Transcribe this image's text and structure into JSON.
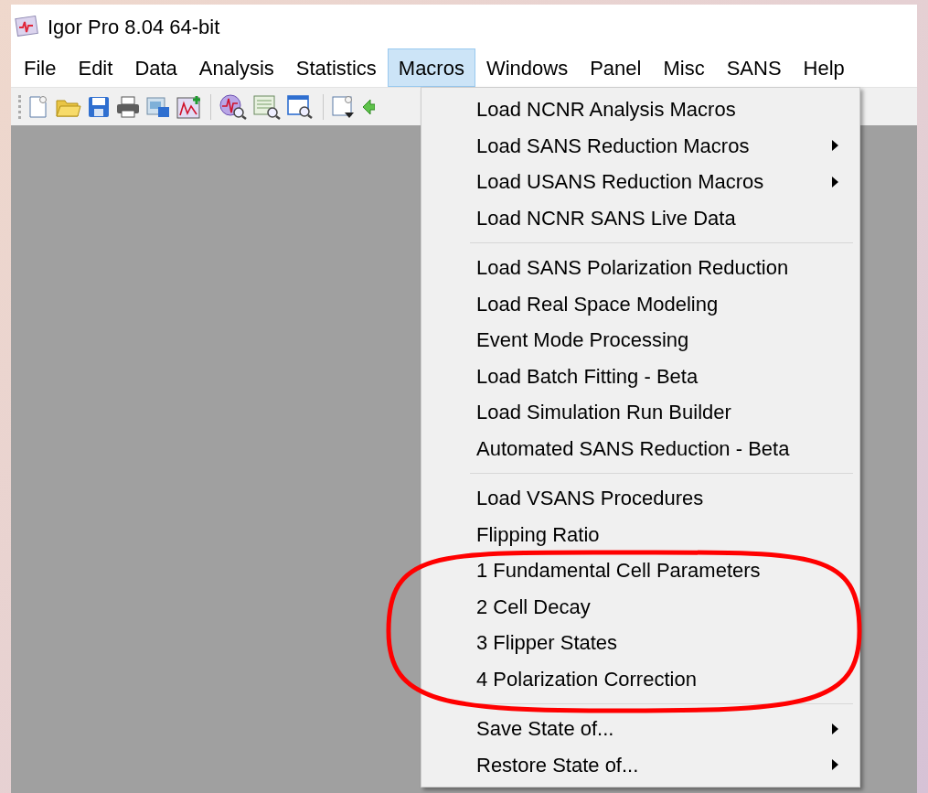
{
  "window": {
    "title": "Igor Pro 8.04 64-bit"
  },
  "menubar": [
    {
      "label": "File",
      "selected": false
    },
    {
      "label": "Edit",
      "selected": false
    },
    {
      "label": "Data",
      "selected": false
    },
    {
      "label": "Analysis",
      "selected": false
    },
    {
      "label": "Statistics",
      "selected": false
    },
    {
      "label": "Macros",
      "selected": true
    },
    {
      "label": "Windows",
      "selected": false
    },
    {
      "label": "Panel",
      "selected": false
    },
    {
      "label": "Misc",
      "selected": false
    },
    {
      "label": "SANS",
      "selected": false
    },
    {
      "label": "Help",
      "selected": false
    }
  ],
  "menu": {
    "sections": [
      [
        {
          "label": "Load NCNR Analysis Macros",
          "submenu": false
        },
        {
          "label": "Load SANS Reduction Macros",
          "submenu": true
        },
        {
          "label": "Load USANS Reduction Macros",
          "submenu": true
        },
        {
          "label": "Load NCNR SANS Live Data",
          "submenu": false
        }
      ],
      [
        {
          "label": "Load SANS Polarization Reduction",
          "submenu": false
        },
        {
          "label": "Load Real Space Modeling",
          "submenu": false
        },
        {
          "label": "Event Mode Processing",
          "submenu": false
        },
        {
          "label": "Load Batch Fitting - Beta",
          "submenu": false
        },
        {
          "label": "Load Simulation Run Builder",
          "submenu": false
        },
        {
          "label": "Automated SANS Reduction - Beta",
          "submenu": false
        }
      ],
      [
        {
          "label": "Load VSANS Procedures",
          "submenu": false
        },
        {
          "label": "Flipping Ratio",
          "submenu": false
        },
        {
          "label": "1 Fundamental Cell Parameters",
          "submenu": false
        },
        {
          "label": "2 Cell Decay",
          "submenu": false
        },
        {
          "label": "3 Flipper States",
          "submenu": false
        },
        {
          "label": "4 Polarization Correction",
          "submenu": false
        }
      ],
      [
        {
          "label": "Save State of...",
          "submenu": true
        },
        {
          "label": "Restore State of...",
          "submenu": true
        }
      ]
    ]
  }
}
